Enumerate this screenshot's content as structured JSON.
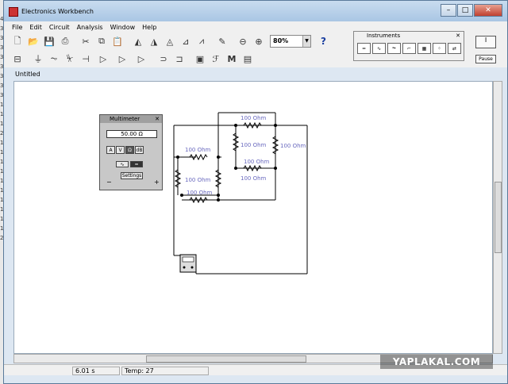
{
  "app": {
    "title": "Electronics Workbench"
  },
  "window_buttons": {
    "minimize": "–",
    "maximize": "□",
    "close": "✕"
  },
  "menu": [
    "File",
    "Edit",
    "Circuit",
    "Analysis",
    "Window",
    "Help"
  ],
  "toolbar": {
    "zoom_value": "80%",
    "help_label": "?"
  },
  "instruments_panel": {
    "title": "Instruments"
  },
  "power_switch": {
    "label": "I"
  },
  "pause_button": {
    "label": "Pause"
  },
  "document": {
    "title": "Untitled"
  },
  "multimeter": {
    "title": "Multimeter",
    "display": "50.00  Ω",
    "buttons": [
      "A",
      "V",
      "Ω",
      "dB"
    ],
    "selected_button": "Ω",
    "settings_label": "Settings",
    "minus": "−",
    "plus": "+"
  },
  "circuit": {
    "resistor_label": "100 Ohm",
    "resistor_count": 8
  },
  "status": {
    "time": "6.01 s",
    "temp": "Temp:  27"
  },
  "watermark": "YAPLAKAL.COM",
  "desktop_strip": [
    "4",
    "3",
    "3",
    "3",
    "3",
    "3",
    "3",
    "3",
    "3",
    "1",
    "1",
    "1",
    "2",
    "1",
    "1",
    "1",
    "1",
    "1",
    "1",
    "1",
    "1",
    "1",
    "1",
    "2"
  ],
  "colors": {
    "resistor_label": "#6a6abf",
    "wire": "#000000"
  }
}
